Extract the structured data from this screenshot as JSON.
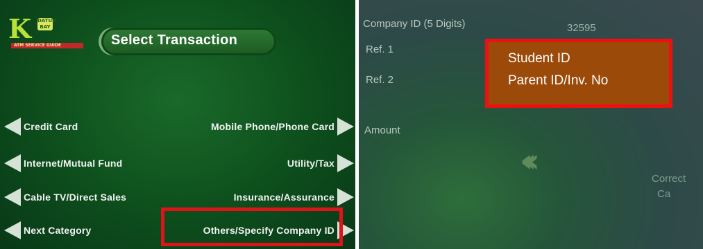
{
  "left_screen": {
    "logo": {
      "mark": "K",
      "badge": "DATUD BAY",
      "strip": "ATM SERVICE GUIDE"
    },
    "title": "Select Transaction",
    "options_left": [
      {
        "label": "Credit Card",
        "icon": "arrow-left-icon"
      },
      {
        "label": "Internet/Mutual Fund",
        "icon": "arrow-left-icon"
      },
      {
        "label": "Cable TV/Direct Sales",
        "icon": "arrow-left-icon"
      },
      {
        "label": "Next Category",
        "icon": "arrow-left-icon"
      }
    ],
    "options_right": [
      {
        "label": "Mobile Phone/Phone Card",
        "icon": "arrow-right-icon"
      },
      {
        "label": "Utility/Tax",
        "icon": "arrow-right-icon"
      },
      {
        "label": "Insurance/Assurance",
        "icon": "arrow-right-icon"
      },
      {
        "label": "Others/Specify Company ID",
        "icon": "arrow-right-icon"
      }
    ],
    "highlight_color": "#e0121a"
  },
  "right_screen": {
    "company_id_label": "Company ID (5 Digits)",
    "company_id_value": "32595",
    "ref1_label": "Ref. 1",
    "ref2_label": "Ref. 2",
    "amount_label": "Amount",
    "side_buttons": [
      "Correct",
      "Ca"
    ],
    "overlay": {
      "line1": "Student ID",
      "line2": "Parent ID/Inv. No",
      "bg_color": "#9c4a0a",
      "border_color": "#ee1010"
    }
  }
}
